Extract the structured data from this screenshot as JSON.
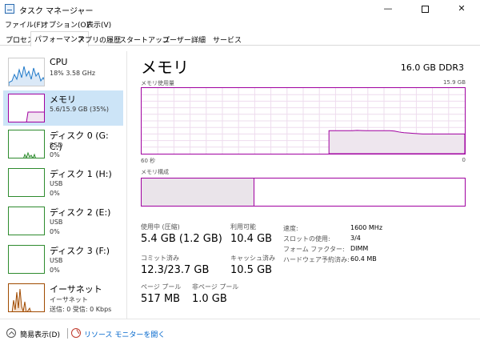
{
  "window": {
    "title": "タスク マネージャー",
    "minimize": "—",
    "close": "✕"
  },
  "menu": [
    "ファイル(F)",
    "オプション(O)",
    "表示(V)"
  ],
  "tabs": [
    "プロセス",
    "パフォーマンス",
    "アプリの履歴",
    "スタートアップ",
    "ユーザー",
    "詳細",
    "サービス"
  ],
  "active_tab": "パフォーマンス",
  "sidebar": [
    {
      "title": "CPU",
      "sub": "18%  3.58 GHz",
      "sub2": "",
      "color": "#1e78c8"
    },
    {
      "title": "メモリ",
      "sub": "5.6/15.9 GB (35%)",
      "sub2": "",
      "color": "#a000a0"
    },
    {
      "title": "ディスク 0 (G: C:)",
      "sub": "SSD",
      "sub2": "0%",
      "color": "#2e8b2e"
    },
    {
      "title": "ディスク 1 (H:)",
      "sub": "USB",
      "sub2": "0%",
      "color": "#2e8b2e"
    },
    {
      "title": "ディスク 2 (E:)",
      "sub": "USB",
      "sub2": "0%",
      "color": "#2e8b2e"
    },
    {
      "title": "ディスク 3 (F:)",
      "sub": "USB",
      "sub2": "0%",
      "color": "#2e8b2e"
    },
    {
      "title": "イーサネット",
      "sub": "イーサネット",
      "sub2": "送信: 0 受信: 0 Kbps",
      "color": "#a04a00"
    }
  ],
  "main": {
    "title": "メモリ",
    "capacity": "16.0 GB DDR3",
    "usage_label": "メモリ使用量",
    "usage_max": "15.9 GB",
    "time_left": "60 秒",
    "time_right": "0",
    "composition_label": "メモリ構成",
    "composition_in_use_fraction": 0.35,
    "usage_history": [
      0,
      0,
      0,
      0,
      0,
      0,
      0,
      0,
      0,
      0,
      0,
      0,
      0,
      0,
      0,
      0,
      0,
      0,
      0,
      0,
      0,
      0,
      0,
      0,
      0,
      0,
      0,
      0,
      0,
      0,
      0,
      0,
      0,
      0,
      0,
      0,
      0,
      0,
      0,
      0,
      0.35,
      0.35,
      0.35,
      0.35,
      0.35,
      0.35,
      0.355,
      0.352,
      0.35,
      0.35,
      0.35,
      0.35,
      0.35,
      0.35,
      0.345,
      0.33,
      0.32,
      0.315,
      0.31,
      0.305,
      0.3,
      0.3,
      0.3,
      0.3,
      0.3,
      0.3,
      0.3,
      0.3,
      0.3,
      0.3
    ],
    "stats": {
      "in_use_label": "使用中 (圧縮)",
      "in_use": "5.4 GB (1.2 GB)",
      "available_label": "利用可能",
      "available": "10.4 GB",
      "committed_label": "コミット済み",
      "committed": "12.3/23.7 GB",
      "cached_label": "キャッシュ済み",
      "cached": "10.5 GB",
      "paged_label": "ページ プール",
      "paged": "517 MB",
      "nonpaged_label": "非ページ プール",
      "nonpaged": "1.0 GB"
    },
    "details": [
      {
        "label": "速度:",
        "value": "1600 MHz"
      },
      {
        "label": "スロットの使用:",
        "value": "3/4"
      },
      {
        "label": "フォーム ファクター:",
        "value": "DIMM"
      },
      {
        "label": "ハードウェア予約済み:",
        "value": "60.4 MB"
      }
    ]
  },
  "footer": {
    "fewer_details": "簡易表示(D)",
    "resource_monitor": "リソース モニターを開く"
  },
  "colors": {
    "memory": "#a000a0",
    "selected": "#cce4f7",
    "link": "#0066cc"
  }
}
